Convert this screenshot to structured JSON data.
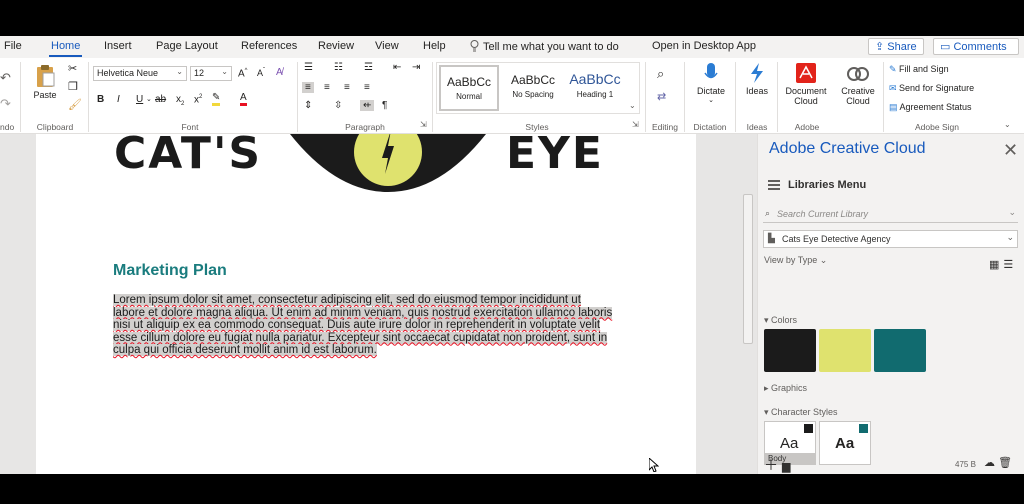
{
  "tabs": [
    {
      "label": "File"
    },
    {
      "label": "Home"
    },
    {
      "label": "Insert"
    },
    {
      "label": "Page Layout"
    },
    {
      "label": "References"
    },
    {
      "label": "Review"
    },
    {
      "label": "View"
    },
    {
      "label": "Help"
    }
  ],
  "tell_me": "Tell me what you want to do",
  "open_desktop": "Open in Desktop App",
  "share_label": "Share",
  "comments_label": "Comments",
  "ribbon": {
    "undo_label": "ndo",
    "clipboard": {
      "paste": "Paste",
      "group": "Clipboard"
    },
    "font": {
      "name": "Helvetica Neue",
      "size": "12",
      "group": "Font"
    },
    "paragraph": {
      "group": "Paragraph"
    },
    "styles": {
      "group": "Styles",
      "items": [
        {
          "sample": "AaBbCc",
          "name": "Normal"
        },
        {
          "sample": "AaBbCc",
          "name": "No Spacing"
        },
        {
          "sample": "AaBbCc",
          "name": "Heading 1"
        }
      ]
    },
    "editing": {
      "group": "Editing"
    },
    "dictation": {
      "button": "Dictate",
      "group": "Dictation"
    },
    "ideas": {
      "button": "Ideas",
      "group": "Ideas"
    },
    "adobe": {
      "document_cloud": "Document Cloud",
      "creative_cloud": "Creative Cloud",
      "group": "Adobe"
    },
    "adobe_sign": {
      "group": "Adobe Sign",
      "items": [
        "Fill and Sign",
        "Send for Signature",
        "Agreement Status"
      ]
    }
  },
  "document": {
    "logo_left": "CAT'S",
    "logo_right": "EYE",
    "heading": "Marketing Plan",
    "body": "Lorem ipsum dolor sit amet, consectetur adipiscing elit, sed do eiusmod tempor incididunt ut labore et dolore magna aliqua. Ut enim ad minim veniam, quis nostrud exercitation ullamco laboris nisi ut aliquip ex ea commodo consequat. Duis aute irure dolor in reprehenderit in voluptate velit esse cillum dolore eu fugiat nulla pariatur. Excepteur sint occaecat cupidatat non proident, sunt in culpa qui officia deserunt mollit anim id est laborum."
  },
  "panel": {
    "title": "Adobe Creative Cloud",
    "menu": "Libraries Menu",
    "search_placeholder": "Search Current Library",
    "library": "Cats Eye Detective Agency",
    "view_by": "View by Type",
    "colors_label": "Colors",
    "colors": [
      "#1b1b1b",
      "#dfe26e",
      "#116b6f"
    ],
    "graphics_label": "Graphics",
    "char_styles_label": "Character Styles",
    "char_styles": [
      {
        "sample": "Aa",
        "label": "Body",
        "chip": "#1b1b1b"
      },
      {
        "sample": "Aa",
        "label": "",
        "chip": "#116b6f"
      }
    ],
    "size": "475 B"
  },
  "colors": {
    "accent": "#185abd",
    "heading": "#1a7c7e",
    "adobe_red": "#e2231a"
  }
}
